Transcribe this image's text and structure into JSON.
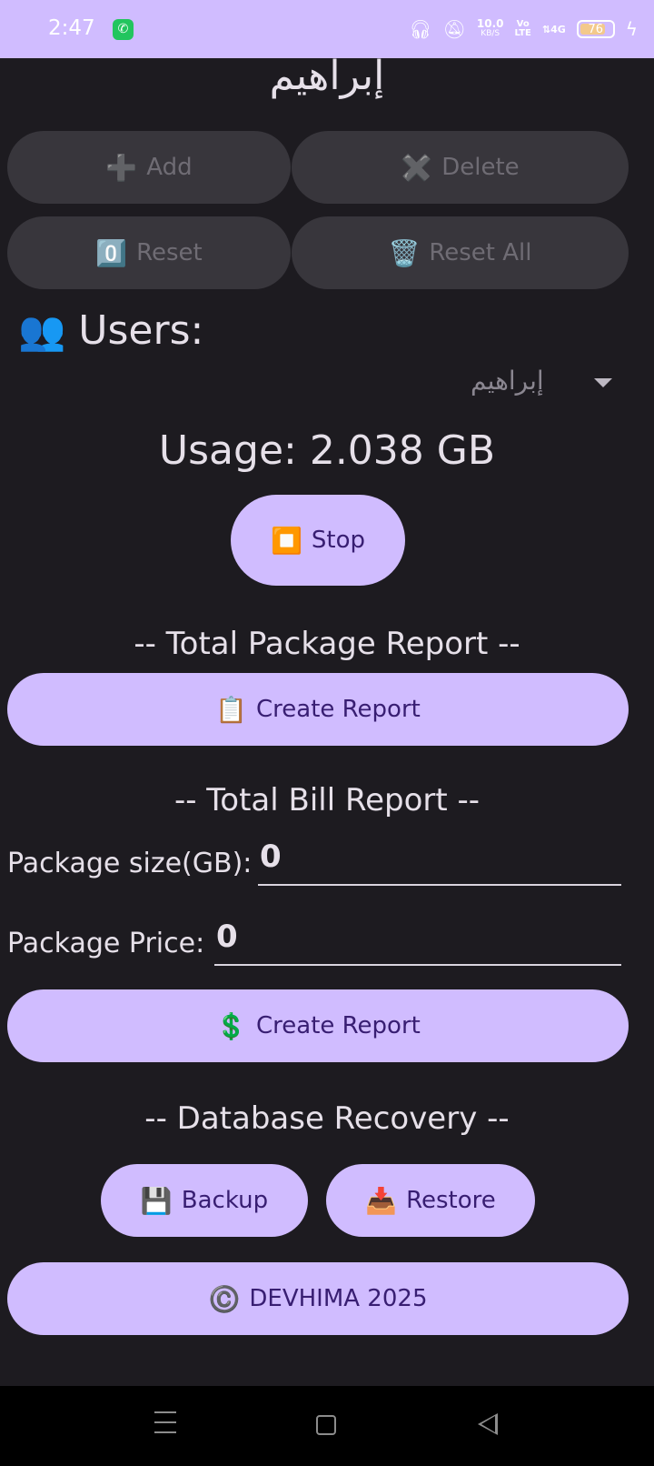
{
  "status_bar": {
    "time": "2:47",
    "call_icon": "phone-icon",
    "speed_value": "10.0",
    "speed_unit": "KB/S",
    "volte_top": "Vo",
    "volte_bottom": "LTE",
    "network": "4G",
    "battery_level": "76"
  },
  "header": {
    "user_name": "إبراهيم"
  },
  "actions": {
    "add": {
      "icon": "➕",
      "label": "Add"
    },
    "delete": {
      "icon": "✖️",
      "label": "Delete"
    },
    "reset": {
      "icon": "0️⃣",
      "label": "Reset"
    },
    "reset_all": {
      "icon": "🗑️",
      "label": "Reset All"
    }
  },
  "users": {
    "icon": "👥",
    "label": "Users:",
    "selected": "إبراهيم"
  },
  "usage": {
    "text": "Usage: 2.038 GB"
  },
  "stop_button": {
    "icon": "⏹️",
    "label": "Stop"
  },
  "package_report": {
    "heading": "-- Total Package Report --",
    "button_icon": "📋",
    "button_label": "Create Report"
  },
  "bill_report": {
    "heading": "-- Total Bill Report --",
    "size_label": "Package size(GB):",
    "size_value": "0",
    "price_label": "Package Price:",
    "price_value": "0",
    "button_icon": "💲",
    "button_label": "Create Report"
  },
  "database": {
    "heading": "-- Database Recovery --",
    "backup_icon": "💾",
    "backup_label": "Backup",
    "restore_icon": "📥",
    "restore_label": "Restore"
  },
  "footer": {
    "icon": "©️",
    "label": "DEVHIMA 2025"
  },
  "colors": {
    "accent": "#d0bcff",
    "background": "#1d1b20",
    "disabled_button": "#38363c",
    "button_text": "#381e72"
  }
}
